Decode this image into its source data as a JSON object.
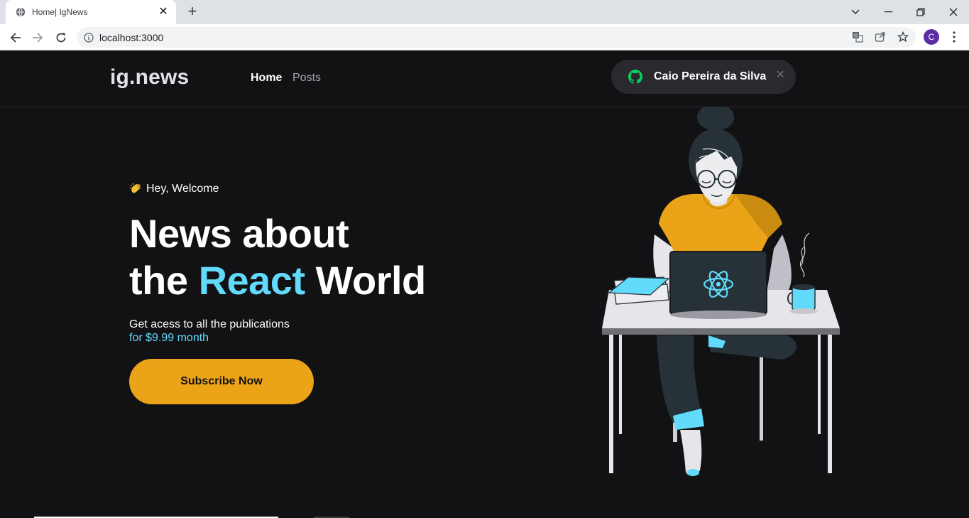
{
  "browser": {
    "tab_title": "Home| IgNews",
    "new_tab": "+",
    "url": "localhost:3000",
    "profile_initial": "C"
  },
  "header": {
    "logo": "ig.news",
    "nav": [
      {
        "label": "Home",
        "active": true
      },
      {
        "label": "Posts",
        "active": false
      }
    ],
    "user_name": "Caio Pereira da Silva",
    "signout_icon": "close-icon"
  },
  "hero": {
    "greeting": "Hey, Welcome",
    "headline_line1": "News about",
    "headline_the": "the ",
    "headline_accent": "React",
    "headline_world": " World",
    "subtitle": "Get acess to all the publications",
    "price": "for $9.99 month",
    "cta": "Subscribe Now"
  },
  "colors": {
    "background": "#121214",
    "accent_cyan": "#61dafb",
    "cta_yellow": "#eba417",
    "pill_bg": "#29292e",
    "github_green": "#04d361"
  }
}
